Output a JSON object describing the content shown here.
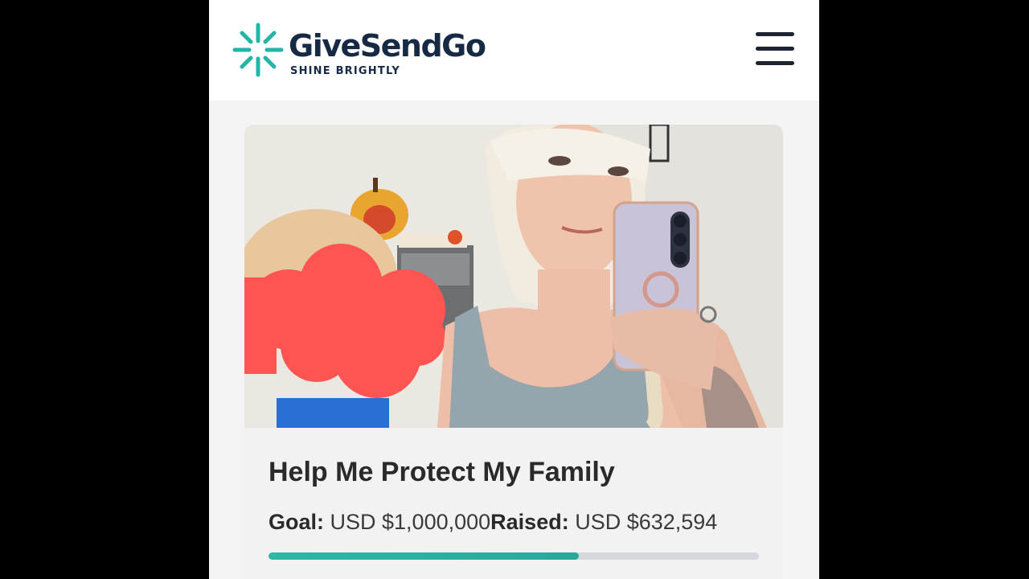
{
  "header": {
    "brand": "GiveSendGo",
    "tagline": "SHINE BRIGHTLY",
    "logo_icon": "sparkle-logo-icon",
    "menu_icon": "hamburger-menu-icon",
    "accent_color": "#25b5a6",
    "brand_color": "#172a45"
  },
  "campaign": {
    "image_icon": "campaign-photo",
    "title": "Help Me Protect My Family",
    "goal_label": "Goal:",
    "goal_value": " USD $1,000,000",
    "raised_label": "Raised:",
    "raised_value": " USD $632,594",
    "progress_fraction": 0.632594
  }
}
